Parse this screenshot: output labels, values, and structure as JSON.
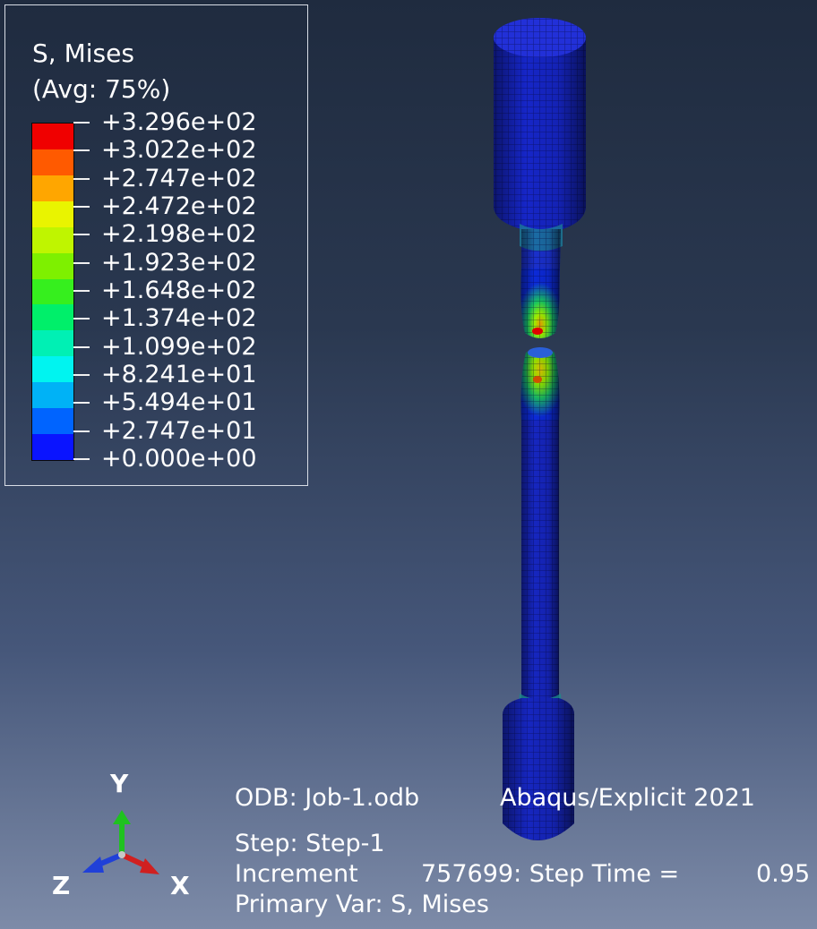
{
  "legend": {
    "title": "S, Mises",
    "subtitle": "(Avg: 75%)",
    "levels": [
      {
        "label": "+3.296e+02",
        "color": "#f00000"
      },
      {
        "label": "+3.022e+02",
        "color": "#ff5a00"
      },
      {
        "label": "+2.747e+02",
        "color": "#ffa600"
      },
      {
        "label": "+2.472e+02",
        "color": "#e9f400"
      },
      {
        "label": "+2.198e+02",
        "color": "#bff500"
      },
      {
        "label": "+1.923e+02",
        "color": "#7ef000"
      },
      {
        "label": "+1.648e+02",
        "color": "#36ef1e"
      },
      {
        "label": "+1.374e+02",
        "color": "#00ef6a"
      },
      {
        "label": "+1.099e+02",
        "color": "#00f0b4"
      },
      {
        "label": "+8.241e+01",
        "color": "#00f4f0"
      },
      {
        "label": "+5.494e+01",
        "color": "#00b2f6"
      },
      {
        "label": "+2.747e+01",
        "color": "#0064ff"
      },
      {
        "label": "+0.000e+00",
        "color": "#0a14ff"
      }
    ]
  },
  "info": {
    "odb": "ODB: Job-1.odb",
    "solver": "Abaqus/Explicit 2021",
    "step": "Step: Step-1",
    "increment_label": "Increment",
    "increment_value": "757699: Step Time =",
    "step_time": "0.95",
    "primary_var": "Primary Var: S, Mises"
  },
  "triad": {
    "y_label": "Y",
    "z_label": "Z",
    "x_label": "X",
    "y_color": "#1fc21f",
    "x_color": "#d02020",
    "z_color": "#2040d8"
  }
}
